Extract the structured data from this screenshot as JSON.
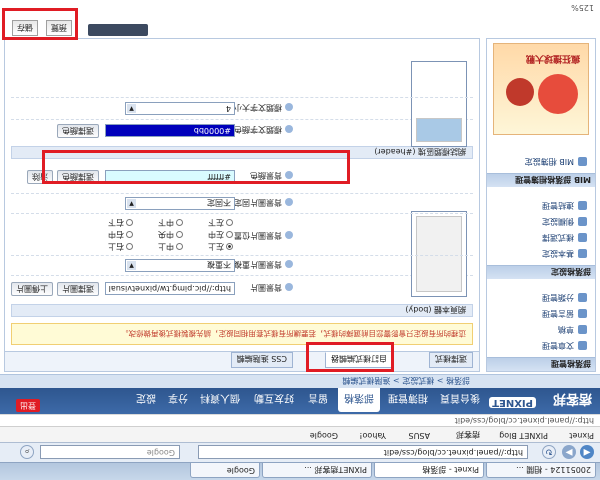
{
  "browser": {
    "tabs": [
      "20051124 - 相關 ...",
      "Pixnet - 部落格",
      "PIXNET痞客邦 ...",
      "Google"
    ],
    "address": "http://panel.pixnet.cc/blog/css/edit",
    "search_placeholder": "Google",
    "bookmarks": [
      "Pixnet",
      "PIXNET Blog",
      "痞客邦",
      "ASUS",
      "Yahoo!",
      "Google"
    ],
    "status_zoom": "125%"
  },
  "site": {
    "logo": "痞客邦",
    "logo_tag": "PIXNET",
    "nav": [
      "後台首頁",
      "相簿管理",
      "部落格",
      "留言",
      "好友互動",
      "個人資料",
      "分享",
      "設定"
    ],
    "active_nav": "部落格",
    "badge": "登出",
    "breadcrumb": "部落格 > 樣式設定 > 進階樣式編輯"
  },
  "sidebar": {
    "sections": [
      {
        "title": "部落格管理",
        "items": [
          "文章管理",
          "草稿",
          "留言管理",
          "分類管理"
        ]
      },
      {
        "title": "部落格設定",
        "items": [
          "基本設定",
          "樣式選擇",
          "側欄設定",
          "連結管理"
        ]
      },
      {
        "title": "MIB 部落格相簿管理",
        "items": [
          "MIB 相簿設定"
        ]
      }
    ]
  },
  "main": {
    "style_tabs": [
      "選擇樣式",
      "自訂樣式編輯器",
      "CSS 進階編輯"
    ],
    "active_style_tab": "自訂樣式編輯器",
    "notice": "這裡的所有設定只會影響您目前選擇的樣式，若要讓所有樣式套用相同設定，請先複製樣式後再做修改。",
    "sections": {
      "body": {
        "title": "網頁本體 (body)",
        "bg_image_label": "背景圖片",
        "bg_image_value": "http://pic.pimg.tw/pixnetvisual",
        "choose_label": "選擇圖片",
        "upload_label": "上傳圖片",
        "repeat_label": "背景圖片重複",
        "repeat_value": "不重複",
        "position_label": "背景圖片位置",
        "positions": [
          "左上",
          "中上",
          "右上",
          "左中",
          "中央",
          "右中",
          "左下",
          "中下",
          "右下"
        ],
        "selected_position": "左上",
        "fixed_label": "背景圖片固定",
        "fixed_value": "不固定"
      },
      "header": {
        "title": "網誌標題區塊 (#header)",
        "bgcolor_label": "背景顏色",
        "bgcolor_value": "#ffffff",
        "pick_color_label": "選擇顏色",
        "clear_label": "清除"
      },
      "title_text": {
        "color_label": "標題文字顏色",
        "color_value": "#0000bb",
        "pick_color_label": "選擇顏色",
        "size_label": "標題文字大小",
        "size_value": "4"
      }
    }
  },
  "top_panel": {
    "save_label": "儲存",
    "cancel_label": "預覽",
    "promo": "瘋狂撞球大戰"
  },
  "colors": {
    "highlight": "#e01c24",
    "nav_bg": "#2e568f",
    "title_color": "#0000bb",
    "notice_bg": "#fffbd6"
  }
}
